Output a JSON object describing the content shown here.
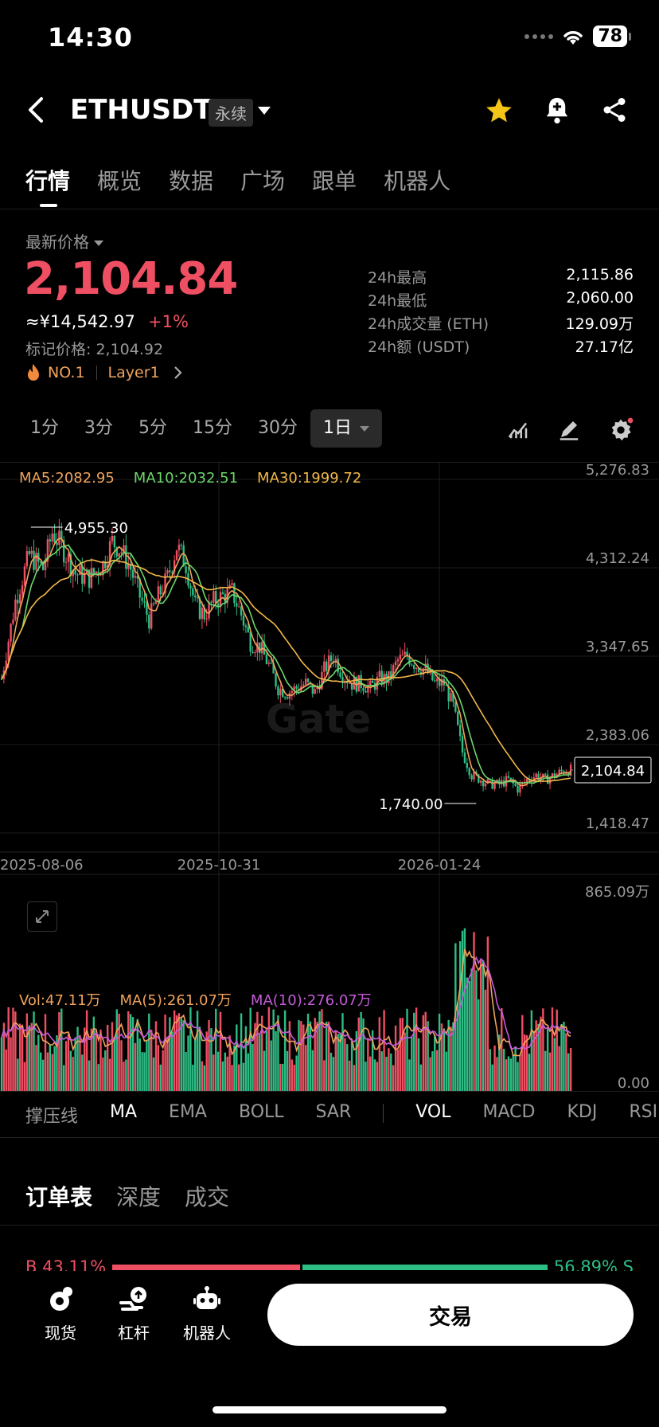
{
  "status_bar": {
    "time": "14:30",
    "battery": "78"
  },
  "header": {
    "symbol": "ETHUSDT",
    "contract_type": "永续"
  },
  "tabs": [
    {
      "label": "行情",
      "active": true
    },
    {
      "label": "概览"
    },
    {
      "label": "数据"
    },
    {
      "label": "广场"
    },
    {
      "label": "跟单"
    },
    {
      "label": "机器人"
    }
  ],
  "ticker": {
    "price_label": "最新价格",
    "last_price": "2,104.84",
    "cny_price": "≈¥14,542.97",
    "change": "+1%",
    "mark_price": "标记价格: 2,104.92",
    "rank_tag": "NO.1",
    "category_tag": "Layer1",
    "stats": [
      {
        "label": "24h最高",
        "value": "2,115.86"
      },
      {
        "label": "24h最低",
        "value": "2,060.00"
      },
      {
        "label": "24h成交量 (ETH)",
        "value": "129.09万"
      },
      {
        "label": "24h额 (USDT)",
        "value": "27.17亿"
      }
    ]
  },
  "intervals": [
    "1分",
    "3分",
    "5分",
    "15分",
    "30分",
    "1日"
  ],
  "selected_interval": "1日",
  "chart_data": {
    "type": "candlestick",
    "ma_legend": [
      {
        "label": "MA5:2082.95",
        "color": "#f0a35b"
      },
      {
        "label": "MA10:2032.51",
        "color": "#6cd66c"
      },
      {
        "label": "MA30:1999.72",
        "color": "#f2b94a"
      }
    ],
    "y_ticks": [
      "5,276.83",
      "4,312.24",
      "3,347.65",
      "2,383.06",
      "1,418.47"
    ],
    "y_tick_values": [
      5276.83,
      4312.24,
      3347.65,
      2383.06,
      1418.47
    ],
    "ylim": [
      1418.47,
      5276.83
    ],
    "x_ticks": [
      "2025-08-06",
      "2025-10-31",
      "2026-01-24"
    ],
    "max_label": "4,955.30",
    "min_label": "1,740.00",
    "current_price_label": "2,104.84",
    "close_path": [
      [
        0,
        3100
      ],
      [
        6,
        3950
      ],
      [
        12,
        4450
      ],
      [
        18,
        4300
      ],
      [
        22,
        4700
      ],
      [
        26,
        4550
      ],
      [
        32,
        4250
      ],
      [
        38,
        4200
      ],
      [
        44,
        4350
      ],
      [
        48,
        4600
      ],
      [
        52,
        4500
      ],
      [
        56,
        4300
      ],
      [
        60,
        4000
      ],
      [
        64,
        3750
      ],
      [
        68,
        4000
      ],
      [
        72,
        4200
      ],
      [
        76,
        4550
      ],
      [
        80,
        4350
      ],
      [
        84,
        3900
      ],
      [
        88,
        3800
      ],
      [
        92,
        3950
      ],
      [
        96,
        4000
      ],
      [
        100,
        4050
      ],
      [
        104,
        3800
      ],
      [
        108,
        3500
      ],
      [
        112,
        3450
      ],
      [
        116,
        3250
      ],
      [
        120,
        3000
      ],
      [
        124,
        2950
      ],
      [
        128,
        3000
      ],
      [
        132,
        3050
      ],
      [
        136,
        2950
      ],
      [
        140,
        3200
      ],
      [
        144,
        3350
      ],
      [
        148,
        3150
      ],
      [
        152,
        3050
      ],
      [
        156,
        3050
      ],
      [
        160,
        3000
      ],
      [
        164,
        3100
      ],
      [
        168,
        3100
      ],
      [
        172,
        3300
      ],
      [
        176,
        3350
      ],
      [
        180,
        3250
      ],
      [
        184,
        3200
      ],
      [
        188,
        3050
      ],
      [
        192,
        3050
      ],
      [
        196,
        2800
      ],
      [
        200,
        2300
      ],
      [
        204,
        2050
      ],
      [
        208,
        2000
      ],
      [
        212,
        1950
      ],
      [
        216,
        1950
      ],
      [
        220,
        2000
      ],
      [
        224,
        1900
      ],
      [
        228,
        2000
      ],
      [
        232,
        2050
      ],
      [
        236,
        2000
      ],
      [
        240,
        2050
      ],
      [
        244,
        2100
      ],
      [
        247,
        2104.84
      ]
    ],
    "volume_max_label": "865.09万",
    "volume_min_label": "0.00"
  },
  "volume_legend": [
    {
      "label": "Vol:47.11万",
      "color": "#f0a35b"
    },
    {
      "label": "MA(5):261.07万",
      "color": "#f0a35b"
    },
    {
      "label": "MA(10):276.07万",
      "color": "#c45bd8"
    }
  ],
  "indicators": [
    "撑压线",
    "MA",
    "EMA",
    "BOLL",
    "SAR",
    "VOL",
    "MACD",
    "KDJ",
    "RSI"
  ],
  "order_tabs": [
    "订单表",
    "深度",
    "成交"
  ],
  "order_ratio": {
    "buy": "B 43.11%",
    "sell": "56.89% S",
    "buy_fraction": 0.4311
  },
  "bottom_nav": [
    {
      "label": "现货"
    },
    {
      "label": "杠杆"
    },
    {
      "label": "机器人"
    }
  ],
  "trade_button": "交易",
  "colors": {
    "up": "#ef4f63",
    "down": "#2ebd85",
    "accent": "#f5c518"
  }
}
